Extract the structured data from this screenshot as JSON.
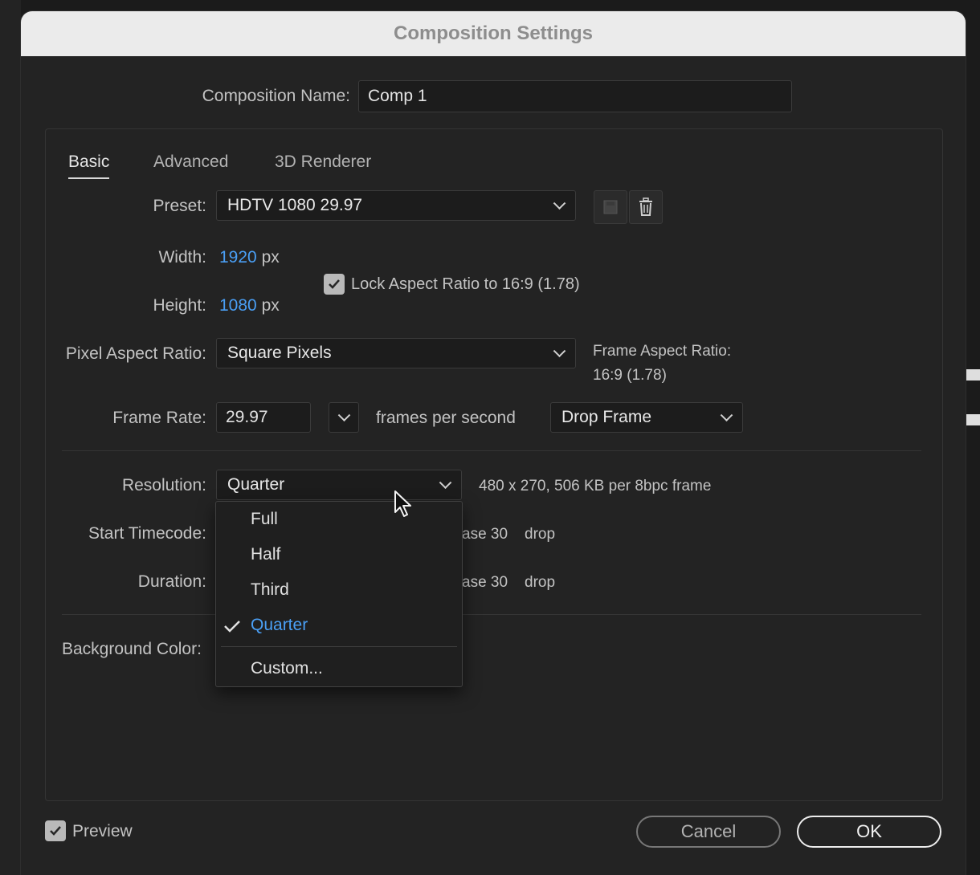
{
  "dialog": {
    "title": "Composition Settings"
  },
  "composition_name": {
    "label": "Composition Name:",
    "value": "Comp 1"
  },
  "tabs": [
    {
      "label": "Basic",
      "active": true
    },
    {
      "label": "Advanced",
      "active": false
    },
    {
      "label": "3D Renderer",
      "active": false
    }
  ],
  "preset": {
    "label": "Preset:",
    "value": "HDTV 1080 29.97"
  },
  "width": {
    "label": "Width:",
    "value": "1920",
    "unit": "px"
  },
  "height": {
    "label": "Height:",
    "value": "1080",
    "unit": "px"
  },
  "lock_aspect": {
    "label": "Lock Aspect Ratio to 16:9 (1.78)",
    "checked": true
  },
  "pixel_aspect": {
    "label": "Pixel Aspect Ratio:",
    "value": "Square Pixels"
  },
  "frame_aspect": {
    "label": "Frame Aspect Ratio:",
    "value": "16:9 (1.78)"
  },
  "frame_rate": {
    "label": "Frame Rate:",
    "value": "29.97",
    "unit_text": "frames per second",
    "drop_value": "Drop Frame"
  },
  "resolution": {
    "label": "Resolution:",
    "value": "Quarter",
    "info": "480 x 270, 506 KB per 8bpc frame"
  },
  "start_timecode": {
    "label": "Start Timecode:",
    "suffix_base": "ase 30",
    "suffix_drop": "drop"
  },
  "duration": {
    "label": "Duration:",
    "suffix_base": "ase 30",
    "suffix_drop": "drop"
  },
  "background_color": {
    "label": "Background Color:"
  },
  "resolution_menu": {
    "items": [
      "Full",
      "Half",
      "Third",
      "Quarter"
    ],
    "selected": "Quarter",
    "custom": "Custom..."
  },
  "preview": {
    "label": "Preview",
    "checked": true
  },
  "buttons": {
    "cancel": "Cancel",
    "ok": "OK"
  },
  "colors": {
    "accent": "#4a9ff5",
    "titlebar": "#ebebeb",
    "dialog_bg": "#232323"
  }
}
